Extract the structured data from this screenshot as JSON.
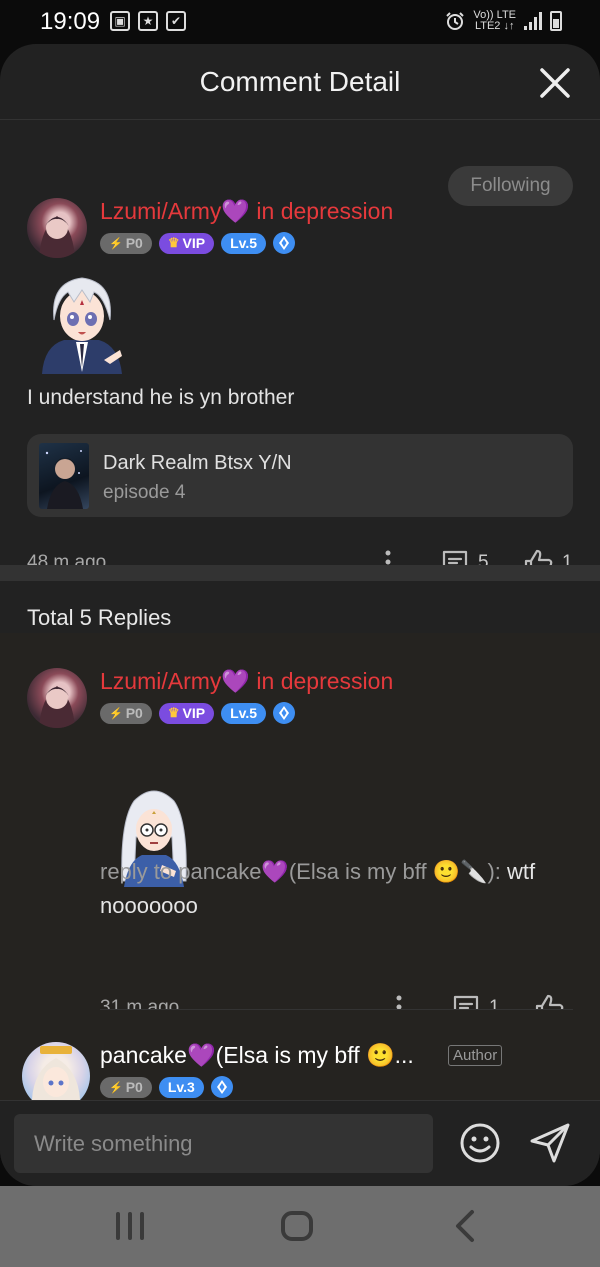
{
  "status_bar": {
    "time": "19:09",
    "network_top": "Vo)) LTE",
    "network_bottom": "LTE2 ↓↑"
  },
  "header": {
    "title": "Comment Detail",
    "close_icon": "close-icon"
  },
  "comment": {
    "username": "Lzumi/Army💜 in depression",
    "badges": {
      "power": "P0",
      "vip": "VIP",
      "level": "Lv.5"
    },
    "follow_label": "Following",
    "text": "I understand he is yn brother",
    "story": {
      "title": "Dark Realm Btsx Y/N",
      "episode": "episode 4"
    },
    "time": "48 m ago",
    "reply_count": "5",
    "like_count": "1"
  },
  "replies": {
    "title": "Total 5 Replies",
    "items": [
      {
        "username": "Lzumi/Army💜 in depression",
        "badges": {
          "power": "P0",
          "vip": "VIP",
          "level": "Lv.5"
        },
        "reply_to": "reply to pancake💜(Elsa is my bff 🙂🔪):",
        "text": " wtf nooooooo",
        "time": "31 m ago",
        "reply_count": "1"
      },
      {
        "username": "pancake💜(Elsa is my bff 🙂...",
        "badges": {
          "power": "P0",
          "level": "Lv.3"
        },
        "author_tag": "Author"
      }
    ]
  },
  "compose": {
    "placeholder": "Write something"
  },
  "colors": {
    "username_red": "#e5393c",
    "vip_purple": "#7b4ce0",
    "level_blue": "#3e8ef2",
    "sheet_bg": "#222222"
  }
}
